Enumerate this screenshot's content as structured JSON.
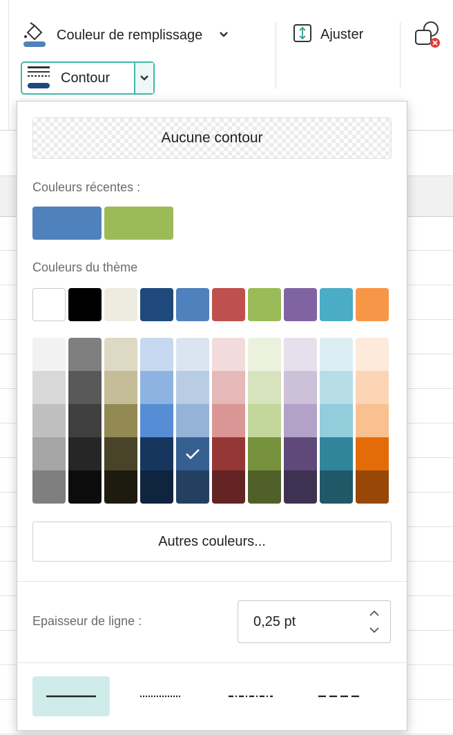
{
  "ribbon": {
    "fill_label": "Couleur de remplissage",
    "outline_label": "Contour",
    "fit_label": "Ajuster"
  },
  "popup": {
    "no_outline_label": "Aucune contour",
    "recent_label": "Couleurs récentes :",
    "recent_colors": [
      "#4f81bd",
      "#9bbb59"
    ],
    "theme_label": "Couleurs du thème",
    "theme_colors": [
      "#ffffff",
      "#000000",
      "#eeece1",
      "#1f497d",
      "#4f81bd",
      "#c0504d",
      "#9bbb59",
      "#8064a2",
      "#4bacc6",
      "#f79646"
    ],
    "theme_shades": [
      [
        "#f2f2f2",
        "#d8d8d8",
        "#bfbfbf",
        "#a5a5a5",
        "#7f7f7f"
      ],
      [
        "#7f7f7f",
        "#595959",
        "#3f3f3f",
        "#262626",
        "#0c0c0c"
      ],
      [
        "#ddd9c3",
        "#c4bd97",
        "#938953",
        "#494429",
        "#1d1b10"
      ],
      [
        "#c6d9f0",
        "#8db3e2",
        "#548dd4",
        "#17365d",
        "#0f243e"
      ],
      [
        "#dbe5f1",
        "#b8cce4",
        "#95b3d7",
        "#366092",
        "#244061"
      ],
      [
        "#f2dcdb",
        "#e5b9b7",
        "#d99694",
        "#953734",
        "#632423"
      ],
      [
        "#ebf1dd",
        "#d7e3bc",
        "#c3d69b",
        "#76923c",
        "#4f6128"
      ],
      [
        "#e5e0ec",
        "#ccc1d9",
        "#b2a2c7",
        "#5f497a",
        "#3f3151"
      ],
      [
        "#dbeef3",
        "#b7dde8",
        "#92cddc",
        "#31859b",
        "#205867"
      ],
      [
        "#fdeada",
        "#fbd5b5",
        "#fac08f",
        "#e36c09",
        "#974806"
      ]
    ],
    "selected_shade": {
      "column": 4,
      "row": 3
    },
    "more_colors_label": "Autres couleurs...",
    "line_weight_label": "Epaisseur de ligne :",
    "line_weight_value": "0,25 pt",
    "line_styles": [
      "solid",
      "dotted",
      "dash-dot",
      "dashed"
    ],
    "selected_line_style": "solid"
  },
  "colors": {
    "accent": "#41b7a6",
    "selected_style_bg": "#cfecea"
  }
}
